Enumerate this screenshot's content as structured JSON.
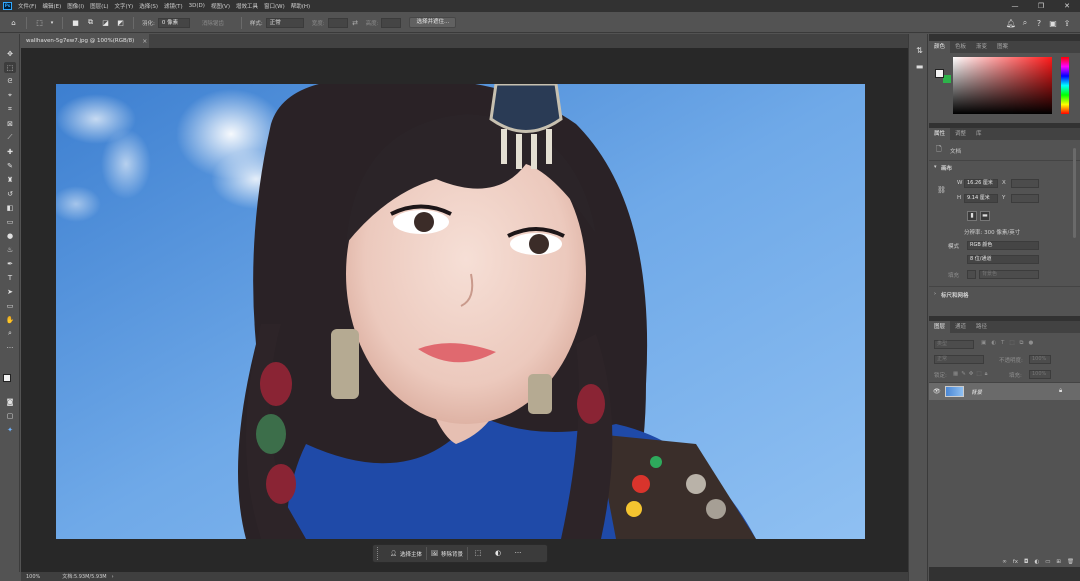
{
  "app": {
    "logo": "Ps"
  },
  "menu": [
    "文件(F)",
    "编辑(E)",
    "图像(I)",
    "图层(L)",
    "文字(Y)",
    "选择(S)",
    "滤镜(T)",
    "3D(D)",
    "视图(V)",
    "增效工具",
    "窗口(W)",
    "帮助(H)"
  ],
  "window_controls": {
    "minimize": "—",
    "restore": "❐",
    "close": "✕"
  },
  "options": {
    "feather_label": "羽化:",
    "feather_value": "0 像素",
    "antialias_label": "消除锯齿",
    "style_label": "样式:",
    "style_value": "正常",
    "width_label": "宽度:",
    "height_label": "高度:",
    "select_mask_button": "选择并遮住..."
  },
  "document": {
    "tab_title": "wallhaven-5g7ew7.jpg @ 100%(RGB/8)",
    "tab_close": "×",
    "zoom": "100%",
    "doc_size": "文档:5.93M/5.93M"
  },
  "taskbar": {
    "select_subject": "选择主体",
    "remove_background": "移除背景",
    "more": "···"
  },
  "color_panel": {
    "tabs": [
      "颜色",
      "色板",
      "渐变",
      "图案"
    ],
    "foreground": "#f2f2f2",
    "background": "#2db34a",
    "hue_color": "#ff1a1a"
  },
  "properties_panel": {
    "tabs": [
      "属性",
      "调整",
      "库"
    ],
    "doc_label": "文档",
    "canvas_section": "画布",
    "w_label": "W",
    "w_value": "16.26 厘米",
    "h_label": "H",
    "h_value": "9.14 厘米",
    "x_label": "X",
    "y_label": "Y",
    "resolution": "分辨率: 300 像素/英寸",
    "mode_label": "模式",
    "mode_value": "RGB 颜色",
    "depth_value": "8 位/通道",
    "fill_label": "填充",
    "fill_value": "背景色",
    "rulers_section": "标尺和网格"
  },
  "layers_panel": {
    "tabs": [
      "图层",
      "通道",
      "路径"
    ],
    "search_placeholder": "类型",
    "blend_mode": "正常",
    "opacity_label": "不透明度:",
    "opacity_value": "100%",
    "lock_label": "锁定:",
    "fill_label": "填充:",
    "fill_value": "100%",
    "layers": [
      {
        "name": "背景",
        "visible": true,
        "locked": true
      }
    ]
  }
}
